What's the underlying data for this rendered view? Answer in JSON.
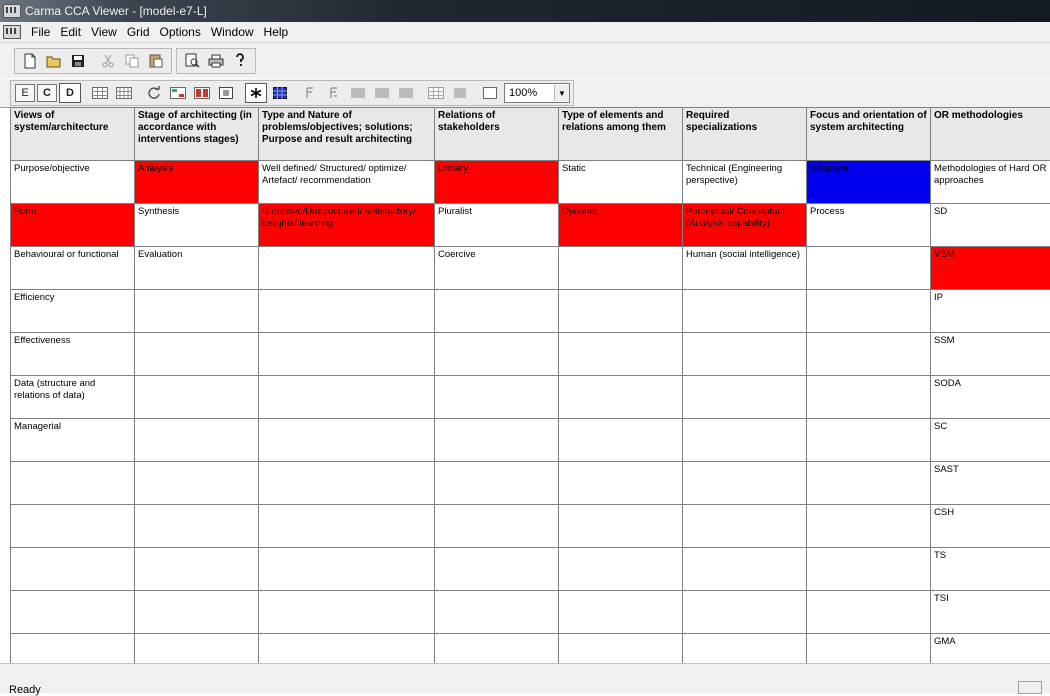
{
  "window": {
    "title": "Carma CCA Viewer - [model-e7-L]"
  },
  "menu": [
    "File",
    "Edit",
    "View",
    "Grid",
    "Options",
    "Window",
    "Help"
  ],
  "toolbar2": {
    "e_label": "E",
    "c_label": "C",
    "d_label": "D",
    "zoom_value": "100%"
  },
  "grid": {
    "headers": [
      "Views of system/architecture",
      "Stage of architecting (in accordance with interventions stages)",
      "Type and Nature of problems/objectives; solutions; Purpose and result architecting",
      "Relations of stakeholders",
      "Type of elements and relations among them",
      "Required specializations",
      "Focus and orientation of system architecting",
      "OR methodologies"
    ],
    "rows": [
      [
        "Purpose/objective",
        "Analysis",
        "Well defined/ Structured/ optimize/ Artefact/ recommendation",
        "Unitary",
        "Static",
        "Technical (Engineering perspective)",
        "Structure",
        "Methodologies of Hard OR approaches"
      ],
      [
        "Form",
        "Synthesis",
        "Ill defined/Unstructured/ satisfactory/ insights/ learning",
        "Pluralist",
        "Dynamic",
        "Perceptual/ Conceptual (Analysis capability)",
        "Process",
        "SD"
      ],
      [
        "Behavioural or functional",
        "Evaluation",
        "",
        "Coercive",
        "",
        "Human (social intelligence)",
        "",
        "VSM"
      ],
      [
        "Efficiency",
        "",
        "",
        "",
        "",
        "",
        "",
        "IP"
      ],
      [
        "Effectiveness",
        "",
        "",
        "",
        "",
        "",
        "",
        "SSM"
      ],
      [
        "Data (structure and relations of data)",
        "",
        "",
        "",
        "",
        "",
        "",
        "SODA"
      ],
      [
        "Managerial",
        "",
        "",
        "",
        "",
        "",
        "",
        "SC"
      ],
      [
        "",
        "",
        "",
        "",
        "",
        "",
        "",
        "SAST"
      ],
      [
        "",
        "",
        "",
        "",
        "",
        "",
        "",
        "CSH"
      ],
      [
        "",
        "",
        "",
        "",
        "",
        "",
        "",
        "TS"
      ],
      [
        "",
        "",
        "",
        "",
        "",
        "",
        "",
        "TSI"
      ],
      [
        "",
        "",
        "",
        "",
        "",
        "",
        "",
        "GMA"
      ]
    ],
    "highlighted": [
      {
        "row": 0,
        "col": 1,
        "color": "#ff0000"
      },
      {
        "row": 0,
        "col": 3,
        "color": "#ff0000"
      },
      {
        "row": 0,
        "col": 6,
        "color": "#0000ee"
      },
      {
        "row": 1,
        "col": 0,
        "color": "#ff0000"
      },
      {
        "row": 1,
        "col": 2,
        "color": "#ff0000"
      },
      {
        "row": 1,
        "col": 4,
        "color": "#ff0000"
      },
      {
        "row": 1,
        "col": 5,
        "color": "#ff0000"
      },
      {
        "row": 2,
        "col": 7,
        "color": "#ff0000"
      }
    ]
  },
  "status": {
    "text": "Ready"
  }
}
